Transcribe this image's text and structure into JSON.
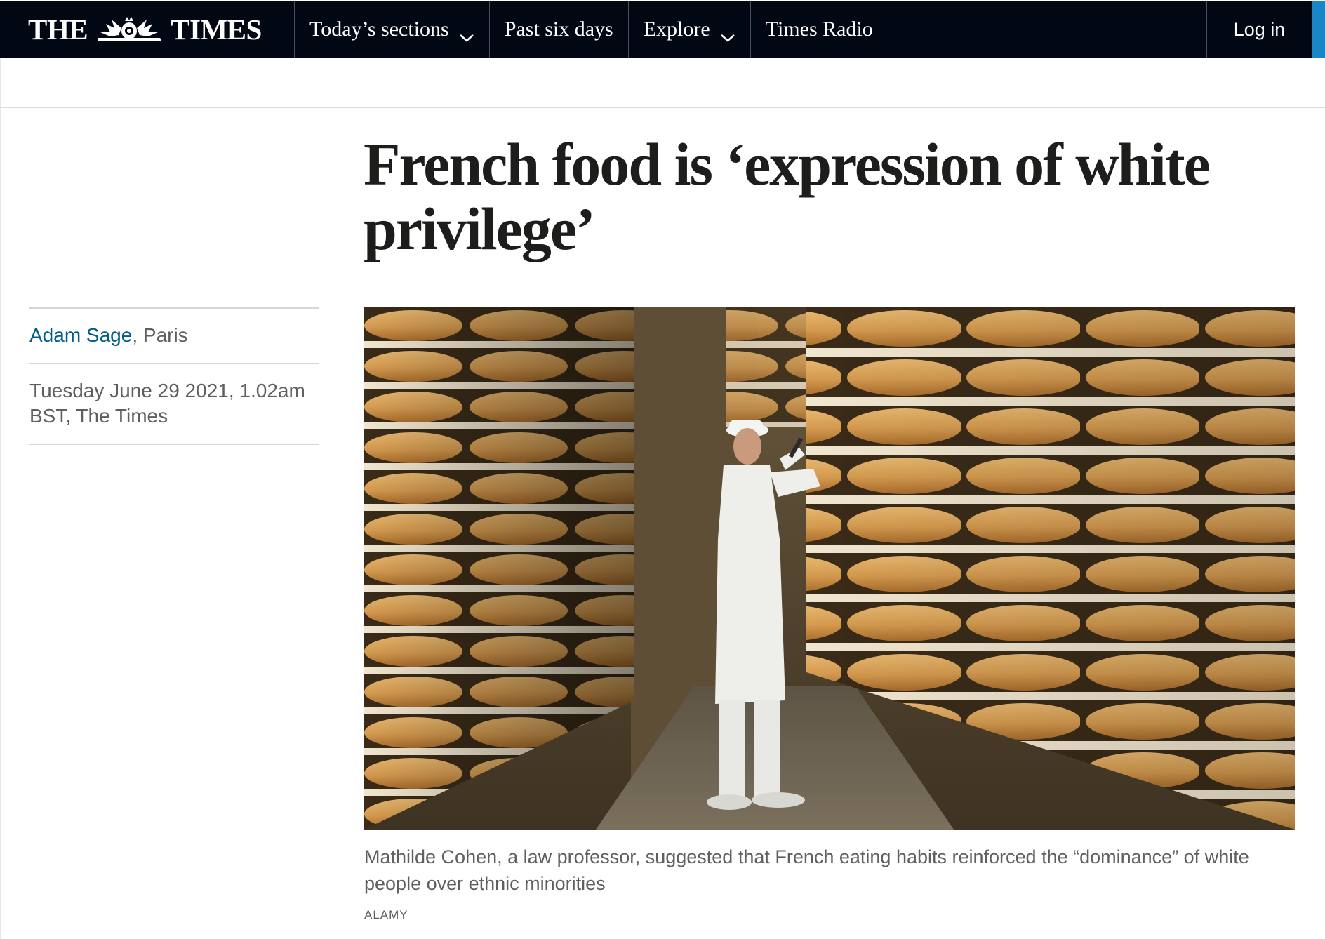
{
  "brand": {
    "logo_left": "THE",
    "logo_right": "TIMES"
  },
  "nav": {
    "items": [
      {
        "label": "Today’s sections",
        "has_dropdown": true
      },
      {
        "label": "Past six days",
        "has_dropdown": false
      },
      {
        "label": "Explore",
        "has_dropdown": true
      },
      {
        "label": "Times Radio",
        "has_dropdown": false
      }
    ],
    "login_label": "Log in"
  },
  "article": {
    "headline": "French food is ‘expression of white privilege’",
    "author": "Adam Sage",
    "location_suffix": ", Paris",
    "dateline": "Tuesday June 29 2021, 1.02am BST, The Times",
    "image": {
      "caption": "Mathilde Cohen, a law professor, suggested that French eating habits reinforced the “dominance” of white people over ethnic minorities",
      "credit": "ALAMY"
    }
  },
  "colors": {
    "nav_background": "#020714",
    "accent": "#1b86c6",
    "author_link": "#005c8a",
    "headline": "#1d1d1b"
  }
}
